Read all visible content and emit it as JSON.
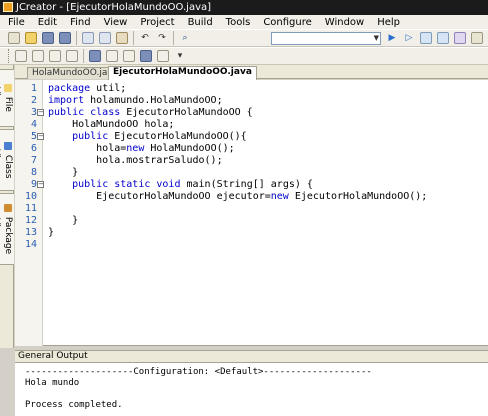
{
  "window": {
    "title": "JCreator - [EjecutorHolaMundoOO.java]"
  },
  "menu": [
    "File",
    "Edit",
    "Find",
    "View",
    "Project",
    "Build",
    "Tools",
    "Configure",
    "Window",
    "Help"
  ],
  "sidebar": {
    "tabs": [
      "File View",
      "Class View",
      "Package View"
    ]
  },
  "tabs": [
    "HolaMundoOO.java",
    "EjecutorHolaMundoOO.java"
  ],
  "editor": {
    "lines": [
      {
        "n": "1",
        "parts": [
          {
            "t": "package",
            "k": true
          },
          {
            "t": " util;"
          }
        ]
      },
      {
        "n": "2",
        "parts": [
          {
            "t": "import",
            "k": true
          },
          {
            "t": " holamundo.HolaMundoOO;"
          }
        ]
      },
      {
        "n": "3",
        "fold": "−",
        "parts": [
          {
            "t": "public class",
            "k": true
          },
          {
            "t": " EjecutorHolaMundoOO {"
          }
        ]
      },
      {
        "n": "4",
        "parts": [
          {
            "t": "    HolaMundoOO hola;"
          }
        ]
      },
      {
        "n": "5",
        "fold": "−",
        "parts": [
          {
            "t": "    "
          },
          {
            "t": "public",
            "k": true
          },
          {
            "t": " EjecutorHolaMundoOO(){"
          }
        ]
      },
      {
        "n": "6",
        "parts": [
          {
            "t": "        hola="
          },
          {
            "t": "new",
            "k": true
          },
          {
            "t": " HolaMundoOO();"
          }
        ]
      },
      {
        "n": "7",
        "parts": [
          {
            "t": "        hola.mostrarSaludo();"
          }
        ]
      },
      {
        "n": "8",
        "parts": [
          {
            "t": "    }"
          }
        ]
      },
      {
        "n": "9",
        "fold": "−",
        "parts": [
          {
            "t": "    "
          },
          {
            "t": "public static void",
            "k": true
          },
          {
            "t": " main(String[] args) {"
          }
        ]
      },
      {
        "n": "10",
        "parts": [
          {
            "t": "        EjecutorHolaMundoOO ejecutor="
          },
          {
            "t": "new",
            "k": true
          },
          {
            "t": " EjecutorHolaMundoOO();"
          }
        ]
      },
      {
        "n": "11",
        "parts": [
          {
            "t": ""
          }
        ]
      },
      {
        "n": "12",
        "parts": [
          {
            "t": "    }"
          }
        ]
      },
      {
        "n": "13",
        "parts": [
          {
            "t": "}"
          }
        ]
      },
      {
        "n": "14",
        "parts": [
          {
            "t": ""
          }
        ]
      }
    ]
  },
  "output": {
    "title": "General Output",
    "lines": [
      "--------------------Configuration: <Default>--------------------",
      "Hola mundo",
      "",
      "Process completed."
    ]
  }
}
